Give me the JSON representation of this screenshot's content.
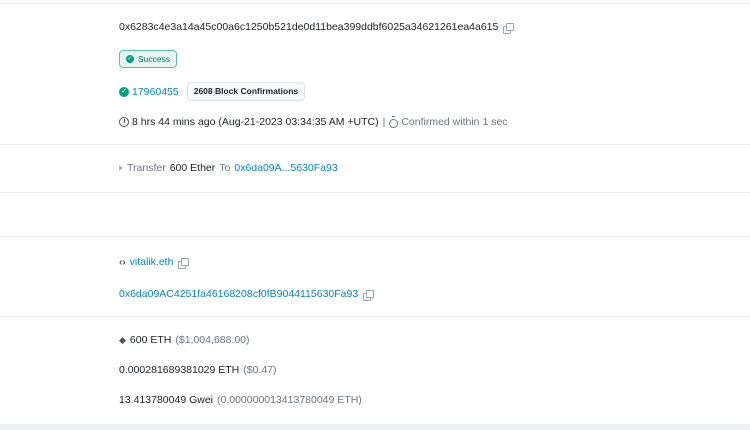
{
  "tx": {
    "hash": "0x6283c4e3a14a45c00a6c1250b521de0d11bea399ddbf6025a34621261ea4a615",
    "status": "Success",
    "block": "17960455",
    "confirmations": "2608 Block Confirmations",
    "timestamp": "8 hrs 44 mins ago (Aug-21-2023 03:34:35 AM +UTC)",
    "separator": "|",
    "confirmed": "Confirmed within 1 sec"
  },
  "action": {
    "prefix": "Transfer",
    "amount": "600 Ether",
    "to_label": "To",
    "to_address": "0x6da09A...5630Fa93"
  },
  "from": {
    "ens": "vitalik.eth",
    "address": "0x6da09AC4251fa46168208cf0fB9044115630Fa93"
  },
  "value": {
    "eth": "600 ETH",
    "usd": "($1,004,688.00)"
  },
  "fee": {
    "eth": "0.000281689381029 ETH",
    "usd": "($0.47)"
  },
  "gas_price": {
    "gwei": "13.413780049 Gwei",
    "eth": "(0.000000013413780049 ETH)"
  },
  "icons": {
    "copy": "copy-icon",
    "check": "check-circle-icon",
    "clock": "clock-icon",
    "stopwatch": "stopwatch-icon",
    "triangle": "triangle-right-icon",
    "code": "code-icon",
    "eth": "ethereum-icon"
  },
  "colors": {
    "link": "#0784c3",
    "success": "#00a186",
    "success_bg": "#e8f6f1",
    "separator": "#e9ecef"
  }
}
